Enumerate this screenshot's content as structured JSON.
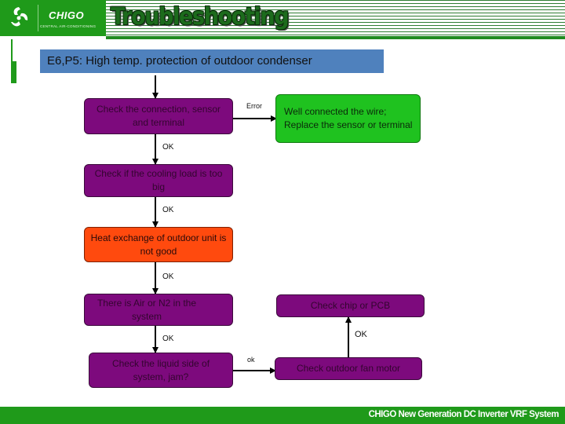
{
  "header": {
    "brand": "CHIGO",
    "brand_subtitle": "CENTRAL AIR-CONDITIONING",
    "title": "Troubleshooting",
    "logo_icon": "chigo-swirl-logo-icon",
    "colors": {
      "brand_green": "#1f9a1a",
      "stripe_green": "#2e7d32"
    }
  },
  "subtitle": "E6,P5: High temp. protection of outdoor condenser",
  "flow": {
    "nodes": [
      {
        "id": "check-connection",
        "text": "Check the connection, sensor and terminal",
        "color": "#7d0a7d"
      },
      {
        "id": "well-connected",
        "text": "Well connected the wire; Replace the sensor or terminal",
        "color": "#1fc21f"
      },
      {
        "id": "cooling-load",
        "text": "Check if the cooling load is too big",
        "color": "#7d0a7d"
      },
      {
        "id": "heat-exchange",
        "text": "Heat exchange of outdoor unit is not good",
        "color": "#ff4a0e"
      },
      {
        "id": "air-n2",
        "text": "There is Air or N2 in the system",
        "color": "#7d0a7d"
      },
      {
        "id": "liquid-side",
        "text": "Check the liquid side of system, jam?",
        "color": "#7d0a7d"
      },
      {
        "id": "fan-motor",
        "text": "Check outdoor fan motor",
        "color": "#7d0a7d"
      },
      {
        "id": "chip-pcb",
        "text": "Check chip or PCB",
        "color": "#7d0a7d"
      }
    ],
    "edge_labels": {
      "error": "Error",
      "ok1": "OK",
      "ok2": "OK",
      "ok3": "OK",
      "ok4": "OK",
      "ok_lower": "ok",
      "ok_up": "OK"
    }
  },
  "footer": {
    "text": "CHIGO New Generation DC Inverter VRF System"
  }
}
